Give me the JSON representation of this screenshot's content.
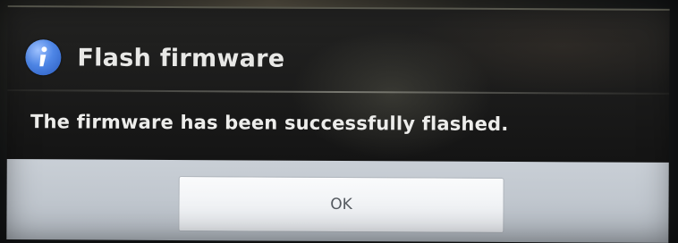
{
  "dialog": {
    "icon": "info-icon",
    "title": "Flash firmware",
    "message": "The firmware has been successfully flashed.",
    "ok_label": "OK"
  },
  "colors": {
    "info_icon": "#4e86e6",
    "body_background": "#1a1a1a",
    "button_bar": "#c2c8cf"
  }
}
